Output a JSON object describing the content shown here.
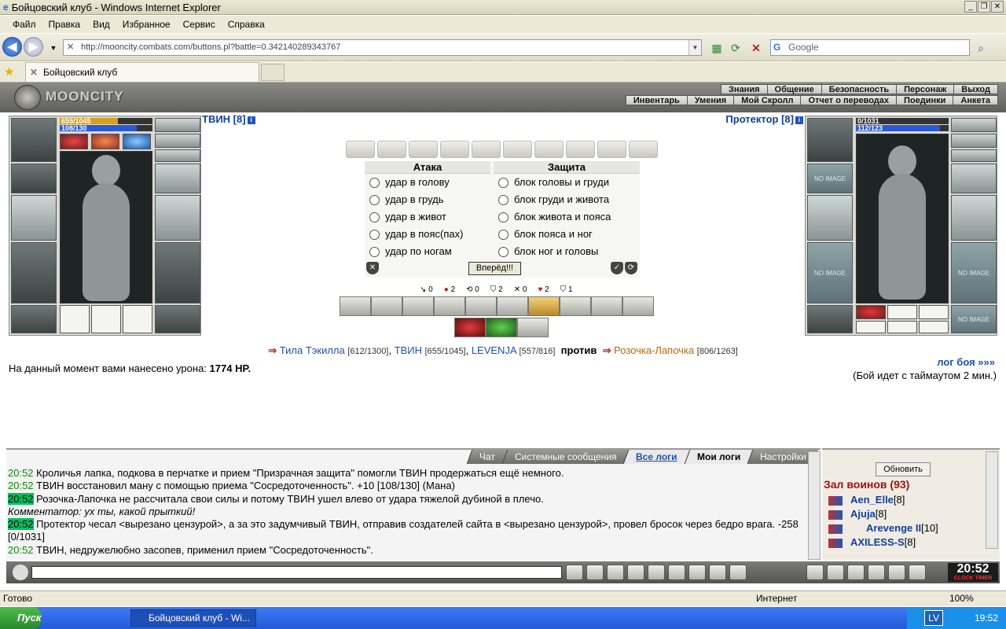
{
  "window": {
    "title": "Бойцовский клуб - Windows Internet Explorer"
  },
  "menu": [
    "Файл",
    "Правка",
    "Вид",
    "Избранное",
    "Сервис",
    "Справка"
  ],
  "address": {
    "url": "http://mooncity.combats.com/buttons.pl?battle=0.342140289343767",
    "search_placeholder": "Google"
  },
  "tabs": [
    {
      "label": "Бойцовский клуб"
    }
  ],
  "game": {
    "logo": "MOONCITY",
    "top_menu": [
      "Знания",
      "Общение",
      "Безопасность",
      "Персонаж",
      "Выход"
    ],
    "sub_menu": [
      "Инвентарь",
      "Умения",
      "Мой Скролл",
      "Отчет о переводах",
      "Поединки",
      "Анкета"
    ],
    "player_left": {
      "name": "ТВИН [8]",
      "hp": "655/1045",
      "mana": "108/130",
      "hp_fraction": 0.63,
      "mana_fraction": 0.83
    },
    "player_right": {
      "name": "Протектор [8]",
      "hp": "0/1031",
      "mana": "112/123",
      "hp_fraction": 0.0,
      "mana_fraction": 0.91
    },
    "no_image": "NO IMAGE",
    "attack": {
      "header": "Атака",
      "options": [
        "удар в голову",
        "удар в грудь",
        "удар в живот",
        "удар в пояс(пах)",
        "удар по ногам"
      ]
    },
    "defense": {
      "header": "Защита",
      "options": [
        "блок головы и груди",
        "блок груди и живота",
        "блок живота и пояса",
        "блок пояса и ног",
        "блок ног и головы"
      ]
    },
    "forward_button": "Вперёд!!!",
    "stats": [
      "0",
      "2",
      "0",
      "2",
      "0",
      "2",
      "1"
    ],
    "vs": {
      "team1": [
        {
          "name": "Тила Тэкилла",
          "hp": "[612/1300]"
        },
        {
          "name": "ТВИН",
          "hp": "[655/1045]"
        },
        {
          "name": "LEVENJA",
          "hp": "[557/816]"
        }
      ],
      "word": "против",
      "team2": [
        {
          "name": "Розочка-Лапочка",
          "hp": "[806/1263]"
        }
      ]
    },
    "damage_text": "На данный момент вами нанесено урона:",
    "damage_value": "1774 HP.",
    "log_link": "лог боя »»»",
    "timeout_text": "(Бой идет с таймаутом 2 мин.)"
  },
  "chat": {
    "tabs": [
      "Чат",
      "Системные сообщения",
      "Все логи",
      "Мои логи",
      "Настройки"
    ],
    "lines": [
      {
        "time": "20:52",
        "text": "Кроличья лапка, подкова в перчатке и прием \"Призрачная защита\" помогли ТВИН продержаться ещё немного."
      },
      {
        "time": "20:52",
        "text": "ТВИН восстановил ману с помощью приема \"Сосредоточенность\". +10 [108/130] (Мана)"
      },
      {
        "time": "20:52",
        "text": "Розочка-Лапочка не рассчитала свои силы и потому ТВИН ушел влево от удара тяжелой дубиной в плечо."
      },
      {
        "time": "",
        "text": "Комментатор: ух ты, какой прыткий!"
      },
      {
        "time": "20:52",
        "text": "Протектор чесал <вырезано цензурой>, а за это задумчивый ТВИН, отправив создателей сайта в <вырезано цензурой>, провел бросок через бедро врага. -258 [0/1031]"
      },
      {
        "time": "20:52",
        "text": "ТВИН, недружелюбно засопев, применил прием \"Сосредоточенность\"."
      }
    ]
  },
  "sidebar": {
    "refresh": "Обновить",
    "hall": "Зал воинов (93)",
    "users": [
      {
        "name": "Aen_Elle",
        "level": "[8]"
      },
      {
        "name": "Ajuja",
        "level": "[8]"
      },
      {
        "name": "Arevenge II",
        "level": "[10]"
      },
      {
        "name": "AXILESS-S",
        "level": "[8]"
      }
    ]
  },
  "clock": {
    "time": "20:52",
    "label": "CLOCK TIMER"
  },
  "status": {
    "left": "Готово",
    "zone": "Интернет",
    "zoom": "100%"
  },
  "taskbar": {
    "start": "Пуск",
    "task": "Бойцовский клуб - Wi...",
    "lang": "LV",
    "time": "19:52"
  }
}
